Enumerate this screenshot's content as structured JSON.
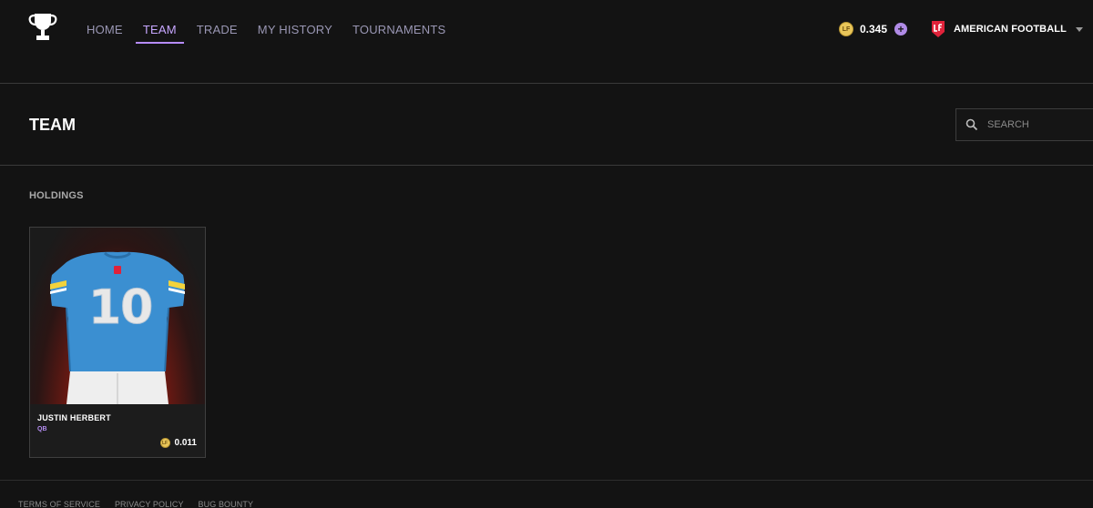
{
  "nav": {
    "items": [
      {
        "label": "HOME",
        "active": false
      },
      {
        "label": "TEAM",
        "active": true
      },
      {
        "label": "TRADE",
        "active": false
      },
      {
        "label": "MY HISTORY",
        "active": false
      },
      {
        "label": "TOURNAMENTS",
        "active": false
      }
    ],
    "balance": {
      "coin_symbol": "LF",
      "value": "0.345"
    },
    "sport": {
      "label": "AMERICAN FOOTBALL"
    }
  },
  "page": {
    "title": "TEAM",
    "search": {
      "placeholder": "SEARCH",
      "value": ""
    },
    "section_label": "HOLDINGS"
  },
  "holdings": [
    {
      "name": "JUSTIN HERBERT",
      "position": "QB",
      "jersey_number": "10",
      "price": "0.011",
      "colors": {
        "jersey": "#3b8fd1",
        "trim": "#f2d33c",
        "glow": "#c12818"
      }
    }
  ],
  "footer": {
    "links": [
      "TERMS OF SERVICE",
      "PRIVACY POLICY",
      "BUG BOUNTY"
    ]
  },
  "theme": {
    "accent": "#b68cff",
    "background": "#131313",
    "coin": "#e9c65a"
  }
}
